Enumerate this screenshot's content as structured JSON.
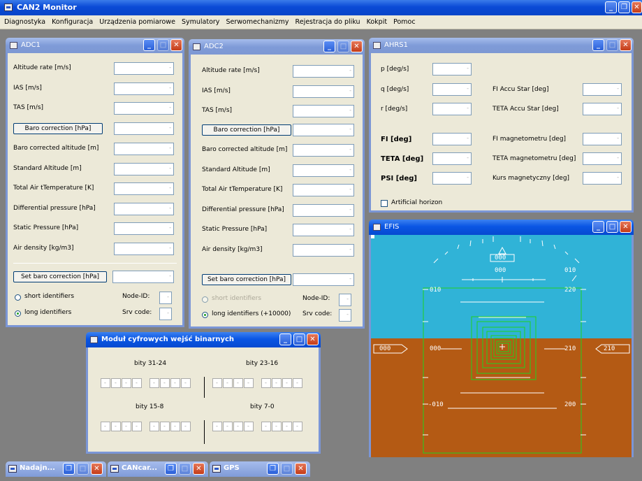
{
  "app": {
    "title": "CAN2 Monitor"
  },
  "menu": [
    "Diagnostyka",
    "Konfiguracja",
    "Urządzenia pomiarowe",
    "Symulatory",
    "Serwomechanizmy",
    "Rejestracja do pliku",
    "Kokpit",
    "Pomoc"
  ],
  "adc1": {
    "title": "ADC1",
    "rows": [
      "Altitude rate [m/s]",
      "IAS [m/s]",
      "TAS [m/s]",
      "Baro correction [hPa]",
      "Baro corrected altitude [m]",
      "Standard Altitude [m]",
      "Total Air tTemperature [K]",
      "Differential pressure [hPa]",
      "Static Pressure [hPa]",
      "Air density [kg/m3]"
    ],
    "set_btn": "Set baro correction [hPa]",
    "short_label": "short identifiers",
    "long_label": "long identifiers",
    "node_label": "Node-ID:",
    "srv_label": "Srv code:",
    "node_value": "-",
    "srv_value": "-"
  },
  "adc2": {
    "title": "ADC2",
    "rows": [
      "Altitude rate [m/s]",
      "IAS [m/s]",
      "TAS [m/s]",
      "Baro correction [hPa]",
      "Baro corrected altitude [m]",
      "Standard Altitude [m]",
      "Total Air tTemperature [K]",
      "Differential pressure [hPa]",
      "Static Pressure [hPa]",
      "Air density [kg/m3]"
    ],
    "set_btn": "Set baro correction [hPa]",
    "short_label": "short identifiers",
    "long_label": "long identifiers (+10000)",
    "node_label": "Node-ID:",
    "srv_label": "Srv code:",
    "node_value": "-",
    "srv_value": "-"
  },
  "ahrs": {
    "title": "AHRS1",
    "left": [
      "p [deg/s]",
      "q [deg/s]",
      "r [deg/s]",
      "FI [deg]",
      "TETA [deg]",
      "PSI [deg]"
    ],
    "right": [
      "FI Accu Star [deg]",
      "TETA Accu Star [deg]",
      "FI magnetometru [deg]",
      "TETA magnetometru [deg]",
      "Kurs magnetyczny [deg]"
    ],
    "horizon": "Artificial horizon"
  },
  "efis": {
    "title": "EFIS",
    "heading_top": "000",
    "heading_mid": "000",
    "pitch_up": "010",
    "pitch_down": "-010",
    "pitch_zero": "000",
    "alt_220": "220",
    "alt_210": "210",
    "alt_200": "200",
    "bank_left": "000",
    "bank_right": "210",
    "spd_10": "010",
    "spd_0": "000",
    "spd_010": "010"
  },
  "modul": {
    "title": "Moduł cyfrowych wejść binarnych",
    "g1": "bity 31-24",
    "g2": "bity 23-16",
    "g3": "bity 15-8",
    "g4": "bity 7-0"
  },
  "min": [
    {
      "title": "Nadajn..."
    },
    {
      "title": "CANcar..."
    },
    {
      "title": "GPS"
    }
  ],
  "colors": {
    "sky": "#2fb4d8",
    "ground": "#b65a12",
    "efis_green": "#1fd21f",
    "title_active": "#0a56e4",
    "title_inactive": "#7f9bd8"
  }
}
